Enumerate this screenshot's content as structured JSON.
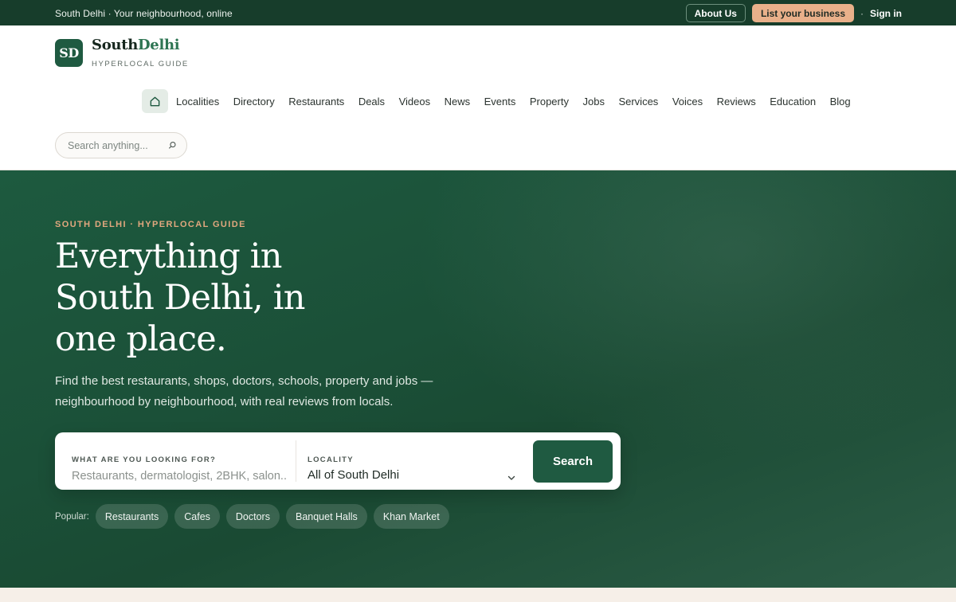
{
  "topbar": {
    "tagline": "South Delhi · Your neighbourhood, online",
    "about_label": "About Us",
    "list_label": "List your business",
    "separator": "·",
    "signin_label": "Sign in"
  },
  "brand": {
    "badge": "SD",
    "name_part1": "South",
    "name_part2": "Delhi",
    "subtitle": "HYPERLOCAL GUIDE"
  },
  "nav": {
    "home_icon": "home-icon",
    "items": [
      "Localities",
      "Directory",
      "Restaurants",
      "Deals",
      "Videos",
      "News",
      "Events",
      "Property",
      "Jobs",
      "Services",
      "Voices",
      "Reviews",
      "Education",
      "Blog"
    ]
  },
  "header_search": {
    "placeholder": "Search anything...",
    "icon": "search-icon"
  },
  "hero": {
    "eyebrow": "SOUTH DELHI · HYPERLOCAL GUIDE",
    "headline": "Everything in South Delhi, in one place.",
    "lede": "Find the best restaurants, shops, doctors, schools, property and jobs — neighbourhood by neighbourhood, with real reviews from locals."
  },
  "search": {
    "what_label": "WHAT ARE YOU LOOKING FOR?",
    "what_placeholder": "Restaurants, dermatologist, 2BHK, salon...",
    "where_label": "LOCALITY",
    "where_value": "All of South Delhi",
    "button_label": "Search"
  },
  "popular": {
    "label": "Popular:",
    "chips": [
      "Restaurants",
      "Cafes",
      "Doctors",
      "Banquet Halls",
      "Khan Market"
    ]
  },
  "colors": {
    "brand_dark": "#173d2b",
    "brand": "#1f5a41",
    "accent": "#e9b08a",
    "eyebrow": "#e1a77e"
  }
}
